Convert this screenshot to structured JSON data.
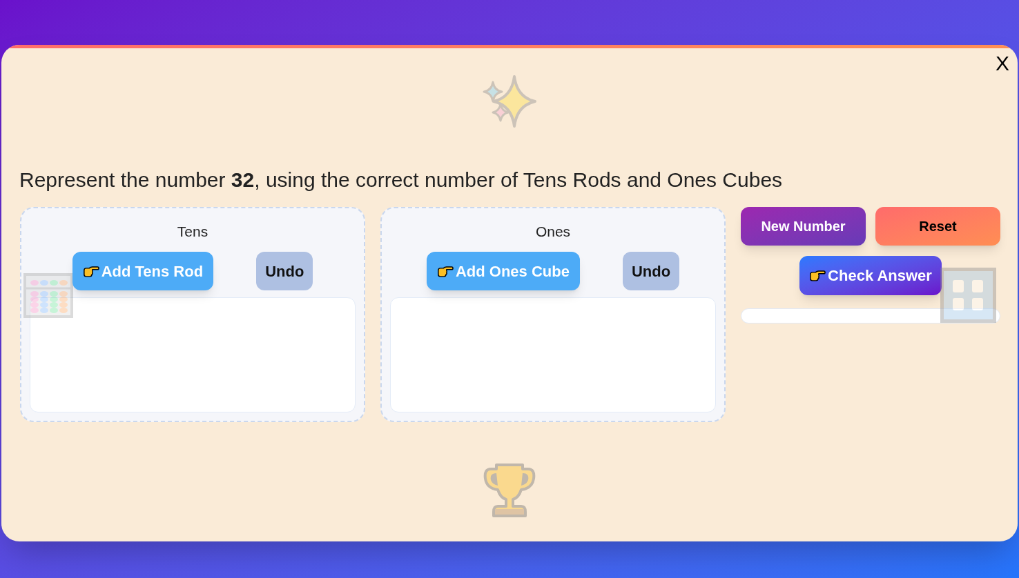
{
  "close_button": {
    "label": "X"
  },
  "prompt": "Represent the number **32**, using the correct number of Tens Rods and Ones Cubes",
  "panels": [
    {
      "title": "Tens",
      "add_button": {
        "label": "Add Tens Rod"
      },
      "undo_button": {
        "label": "Undo"
      }
    },
    {
      "title": "Ones",
      "add_button": {
        "label": "Add Ones Cube"
      },
      "undo_button": {
        "label": "Undo"
      }
    }
  ],
  "actions": {
    "new_number": {
      "label": "New Number"
    },
    "reset": {
      "label": "Reset"
    },
    "check_answer": {
      "label": "Check Answer"
    }
  },
  "progress": {
    "level": 0
  }
}
